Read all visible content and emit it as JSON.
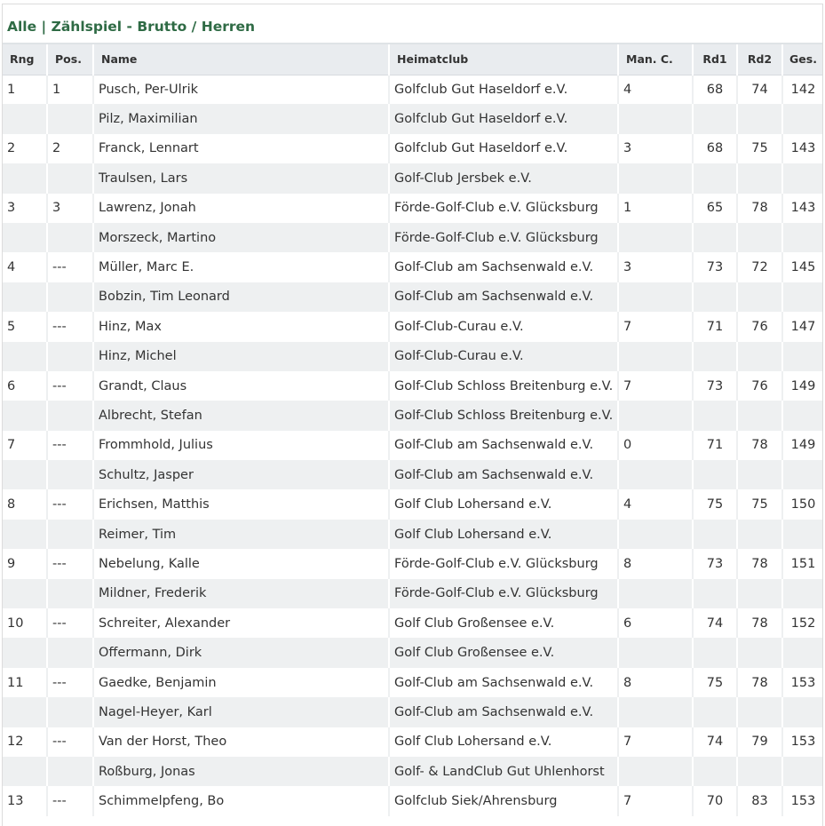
{
  "title": "Alle | Zählspiel - Brutto / Herren",
  "columns": {
    "rng": "Rng",
    "pos": "Pos.",
    "name": "Name",
    "club": "Heimatclub",
    "man": "Man. C.",
    "rd1": "Rd1",
    "rd2": "Rd2",
    "ges": "Ges."
  },
  "rows": [
    {
      "rng": "1",
      "pos": "1",
      "name": "Pusch, Per-Ulrik",
      "club": "Golfclub Gut Haseldorf e.V.",
      "man": "4",
      "rd1": "68",
      "rd2": "74",
      "ges": "142"
    },
    {
      "rng": "",
      "pos": "",
      "name": "Pilz, Maximilian",
      "club": "Golfclub Gut Haseldorf e.V.",
      "man": "",
      "rd1": "",
      "rd2": "",
      "ges": ""
    },
    {
      "rng": "2",
      "pos": "2",
      "name": "Franck, Lennart",
      "club": "Golfclub Gut Haseldorf e.V.",
      "man": "3",
      "rd1": "68",
      "rd2": "75",
      "ges": "143"
    },
    {
      "rng": "",
      "pos": "",
      "name": "Traulsen, Lars",
      "club": "Golf-Club Jersbek e.V.",
      "man": "",
      "rd1": "",
      "rd2": "",
      "ges": ""
    },
    {
      "rng": "3",
      "pos": "3",
      "name": "Lawrenz, Jonah",
      "club": "Förde-Golf-Club e.V. Glücksburg",
      "man": "1",
      "rd1": "65",
      "rd2": "78",
      "ges": "143"
    },
    {
      "rng": "",
      "pos": "",
      "name": "Morszeck, Martino",
      "club": "Förde-Golf-Club e.V. Glücksburg",
      "man": "",
      "rd1": "",
      "rd2": "",
      "ges": ""
    },
    {
      "rng": "4",
      "pos": "---",
      "name": "Müller, Marc E.",
      "club": "Golf-Club am Sachsenwald e.V.",
      "man": "3",
      "rd1": "73",
      "rd2": "72",
      "ges": "145"
    },
    {
      "rng": "",
      "pos": "",
      "name": "Bobzin, Tim Leonard",
      "club": "Golf-Club am Sachsenwald e.V.",
      "man": "",
      "rd1": "",
      "rd2": "",
      "ges": ""
    },
    {
      "rng": "5",
      "pos": "---",
      "name": "Hinz, Max",
      "club": "Golf-Club-Curau e.V.",
      "man": "7",
      "rd1": "71",
      "rd2": "76",
      "ges": "147"
    },
    {
      "rng": "",
      "pos": "",
      "name": "Hinz, Michel",
      "club": "Golf-Club-Curau e.V.",
      "man": "",
      "rd1": "",
      "rd2": "",
      "ges": ""
    },
    {
      "rng": "6",
      "pos": "---",
      "name": "Grandt, Claus",
      "club": "Golf-Club Schloss Breitenburg e.V.",
      "man": "7",
      "rd1": "73",
      "rd2": "76",
      "ges": "149"
    },
    {
      "rng": "",
      "pos": "",
      "name": "Albrecht, Stefan",
      "club": "Golf-Club Schloss Breitenburg e.V.",
      "man": "",
      "rd1": "",
      "rd2": "",
      "ges": ""
    },
    {
      "rng": "7",
      "pos": "---",
      "name": "Frommhold, Julius",
      "club": "Golf-Club am Sachsenwald e.V.",
      "man": "0",
      "rd1": "71",
      "rd2": "78",
      "ges": "149"
    },
    {
      "rng": "",
      "pos": "",
      "name": "Schultz, Jasper",
      "club": "Golf-Club am Sachsenwald e.V.",
      "man": "",
      "rd1": "",
      "rd2": "",
      "ges": ""
    },
    {
      "rng": "8",
      "pos": "---",
      "name": "Erichsen, Matthis",
      "club": "Golf Club Lohersand e.V.",
      "man": "4",
      "rd1": "75",
      "rd2": "75",
      "ges": "150"
    },
    {
      "rng": "",
      "pos": "",
      "name": "Reimer, Tim",
      "club": "Golf Club Lohersand e.V.",
      "man": "",
      "rd1": "",
      "rd2": "",
      "ges": ""
    },
    {
      "rng": "9",
      "pos": "---",
      "name": "Nebelung, Kalle",
      "club": "Förde-Golf-Club e.V. Glücksburg",
      "man": "8",
      "rd1": "73",
      "rd2": "78",
      "ges": "151"
    },
    {
      "rng": "",
      "pos": "",
      "name": "Mildner, Frederik",
      "club": "Förde-Golf-Club e.V. Glücksburg",
      "man": "",
      "rd1": "",
      "rd2": "",
      "ges": ""
    },
    {
      "rng": "10",
      "pos": "---",
      "name": "Schreiter, Alexander",
      "club": "Golf Club Großensee e.V.",
      "man": "6",
      "rd1": "74",
      "rd2": "78",
      "ges": "152"
    },
    {
      "rng": "",
      "pos": "",
      "name": "Offermann, Dirk",
      "club": "Golf Club Großensee e.V.",
      "man": "",
      "rd1": "",
      "rd2": "",
      "ges": ""
    },
    {
      "rng": "11",
      "pos": "---",
      "name": "Gaedke, Benjamin",
      "club": "Golf-Club am Sachsenwald e.V.",
      "man": "8",
      "rd1": "75",
      "rd2": "78",
      "ges": "153"
    },
    {
      "rng": "",
      "pos": "",
      "name": "Nagel-Heyer, Karl",
      "club": "Golf-Club am Sachsenwald e.V.",
      "man": "",
      "rd1": "",
      "rd2": "",
      "ges": ""
    },
    {
      "rng": "12",
      "pos": "---",
      "name": "Van der Horst, Theo",
      "club": "Golf Club Lohersand e.V.",
      "man": "7",
      "rd1": "74",
      "rd2": "79",
      "ges": "153"
    },
    {
      "rng": "",
      "pos": "",
      "name": "Roßburg, Jonas",
      "club": "Golf- & LandClub Gut Uhlenhorst",
      "man": "",
      "rd1": "",
      "rd2": "",
      "ges": ""
    },
    {
      "rng": "13",
      "pos": "---",
      "name": "Schimmelpfeng, Bo",
      "club": "Golfclub Siek/Ahrensburg",
      "man": "7",
      "rd1": "70",
      "rd2": "83",
      "ges": "153"
    }
  ],
  "colors": {
    "title": "#2f6b45",
    "header_bg": "#e9ecef",
    "stripe_bg": "#eef0f1"
  }
}
